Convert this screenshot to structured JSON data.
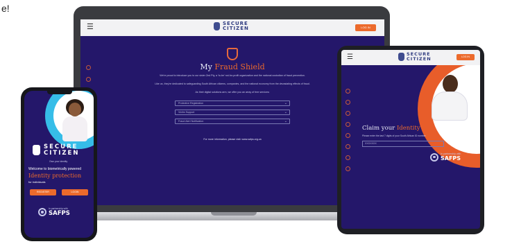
{
  "corner_text": "e!",
  "laptop": {
    "nav": {
      "menu_icon": "hamburger-icon",
      "logo_line1": "SECURE",
      "logo_line2": "CITIZEN",
      "cta": "LOG IN"
    },
    "heading_plain": "My",
    "heading_accent": "Fraud Shield",
    "intro": "We're proud to introduce you to our sister Zed Pty, a 'to-be' not-for-profit organization and the national custodian of fraud prevention.",
    "intro_2": "Like us, they're dedicated to safeguarding South African citizens, companies, and the national economy from the devastating effects of fraud.",
    "intro_3": "As their digital solutions arm, we offer you an array of free services:",
    "fields": [
      "Protective Registration",
      "Victim Support",
      "Fraud Alert Notification"
    ],
    "more_info": "For more information, please visit: www.safps.org.za"
  },
  "tablet": {
    "nav": {
      "menu_icon": "hamburger-icon",
      "logo_line1": "SECURE",
      "logo_line2": "CITIZEN",
      "cta": "LOG IN"
    },
    "heading_plain": "Claim your",
    "heading_accent": "Identity",
    "prompt": "Please enter the last 7 digits of your South African ID number",
    "field_value": "XXXXXXX",
    "partner_small": "In partnership with",
    "partner_big": "SAFPS"
  },
  "phone": {
    "logo_line1": "SECURE",
    "logo_line2": "CITIZEN",
    "tagline": "Own your identity",
    "welcome": "Welcome to biometrically powered",
    "heading": "Identity protection",
    "sub": "for individuals",
    "btn_1": "REGISTER",
    "btn_2": "LOGIN",
    "partner_small": "In partnership with",
    "partner_big": "SAFPS"
  },
  "colors": {
    "screen_bg": "#24176a",
    "accent": "#ec6a2c",
    "nav_bg": "#f2f2f4"
  }
}
